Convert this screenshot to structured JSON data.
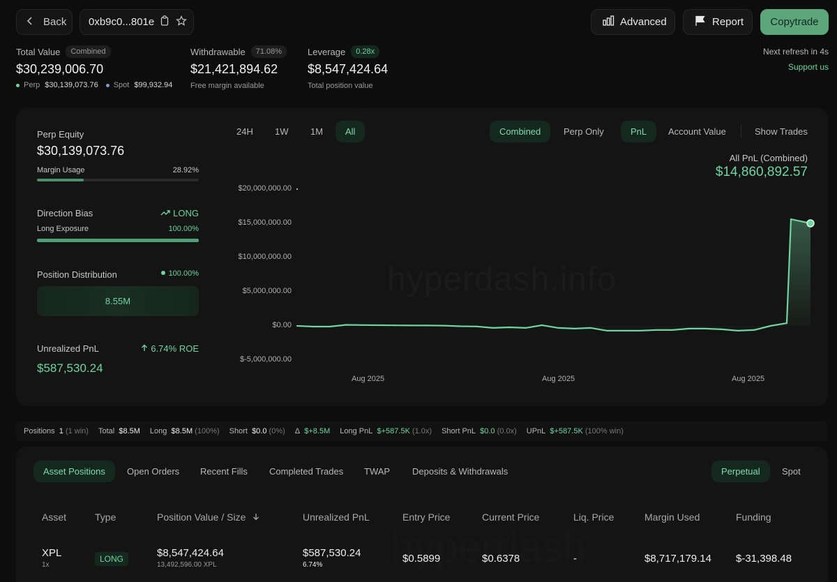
{
  "header": {
    "back_label": "Back",
    "address": "0xb9c0...801e",
    "advanced_label": "Advanced",
    "report_label": "Report",
    "copytrade_label": "Copytrade",
    "next_refresh": "Next refresh in 4s",
    "support": "Support us"
  },
  "summary": {
    "total_value_label": "Total Value",
    "total_value_badge": "Combined",
    "total_value": "$30,239,006.70",
    "perp_label": "Perp",
    "perp_value": "$30,139,073.76",
    "spot_label": "Spot",
    "spot_value": "$99,932.94",
    "withdrawable_label": "Withdrawable",
    "withdrawable_badge": "71.08%",
    "withdrawable_value": "$21,421,894.62",
    "withdrawable_sub": "Free margin available",
    "leverage_label": "Leverage",
    "leverage_badge": "0.28x",
    "leverage_value": "$8,547,424.64",
    "leverage_sub": "Total position value"
  },
  "side": {
    "perp_equity_label": "Perp Equity",
    "perp_equity": "$30,139,073.76",
    "margin_usage_label": "Margin Usage",
    "margin_usage": "28.92%",
    "margin_usage_fraction": 0.2892,
    "direction_bias_label": "Direction Bias",
    "direction_bias": "LONG",
    "long_exposure_label": "Long Exposure",
    "long_exposure": "100.00%",
    "long_exposure_fraction": 1.0,
    "position_distribution_label": "Position Distribution",
    "position_distribution_pct": "100.00%",
    "position_distribution_value": "8.55M",
    "unrealized_pnl_label": "Unrealized PnL",
    "roe": "6.74% ROE",
    "unrealized_pnl": "$587,530.24"
  },
  "chart_controls": {
    "ranges": [
      "24H",
      "1W",
      "1M",
      "All"
    ],
    "active_range": "All",
    "mode_combined": "Combined",
    "mode_perp": "Perp Only",
    "metric_pnl": "PnL",
    "metric_account": "Account Value",
    "show_trades": "Show Trades",
    "pnl_title": "All PnL (Combined)",
    "pnl_value": "$14,860,892.57"
  },
  "chart_data": {
    "type": "area",
    "title": "",
    "xlabel": "",
    "ylabel": "",
    "ylim": [
      -5000000,
      20000000
    ],
    "y_ticks": [
      "$20,000,000.00",
      "$15,000,000.00",
      "$10,000,000.00",
      "$5,000,000.00",
      "$0.00",
      "$-5,000,000.00"
    ],
    "y_tick_values": [
      20000000,
      15000000,
      10000000,
      5000000,
      0,
      -5000000
    ],
    "x_ticks": [
      "Aug 2025",
      "Aug 2025",
      "Aug 2025"
    ],
    "series": [
      {
        "color": "#6fd4a0",
        "values": [
          0,
          -100000,
          -100000,
          150000,
          120000,
          100000,
          80000,
          60000,
          60000,
          40000,
          -50000,
          -80000,
          -300000,
          -200000,
          -300000,
          100000,
          -300000,
          -400000,
          -300000,
          -700000,
          -700000,
          -700000,
          -600000,
          -600000,
          -400000,
          -400000,
          -500000,
          -700000,
          -600000,
          0,
          400000,
          400000,
          15600000,
          15000000
        ]
      }
    ],
    "grid": false,
    "watermark": "hyperdash.info"
  },
  "stats_bar": {
    "positions_label": "Positions",
    "positions_value": "1",
    "positions_note": "(1 win)",
    "total_label": "Total",
    "total_value": "$8.5M",
    "long_label": "Long",
    "long_value": "$8.5M",
    "long_note": "(100%)",
    "short_label": "Short",
    "short_value": "$0.0",
    "short_note": "(0%)",
    "delta_label": "Δ",
    "delta_value": "$+8.5M",
    "longpnl_label": "Long PnL",
    "longpnl_value": "$+587.5K",
    "longpnl_note": "(1.0x)",
    "shortpnl_label": "Short PnL",
    "shortpnl_value": "$0.0",
    "shortpnl_note": "(0.0x)",
    "upnl_label": "UPnL",
    "upnl_value": "$+587.5K",
    "upnl_note": "(100% win)"
  },
  "tabs": {
    "asset_positions": "Asset Positions",
    "open_orders": "Open Orders",
    "recent_fills": "Recent Fills",
    "completed_trades": "Completed Trades",
    "twap": "TWAP",
    "deposits": "Deposits & Withdrawals",
    "perpetual": "Perpetual",
    "spot": "Spot"
  },
  "table": {
    "headers": {
      "asset": "Asset",
      "type": "Type",
      "position": "Position Value / Size",
      "upnl": "Unrealized PnL",
      "entry": "Entry Price",
      "current": "Current Price",
      "liq": "Liq. Price",
      "margin": "Margin Used",
      "funding": "Funding"
    },
    "rows": [
      {
        "asset": "XPL",
        "leverage": "1x",
        "type": "LONG",
        "position_value": "$8,547,424.64",
        "size": "13,492,596.00 XPL",
        "upnl": "$587,530.24",
        "upnl_pct": "6.74%",
        "entry": "$0.5899",
        "current": "$0.6378",
        "liq": "-",
        "margin": "$8,717,179.14",
        "funding": "$-31,398.48"
      }
    ]
  }
}
